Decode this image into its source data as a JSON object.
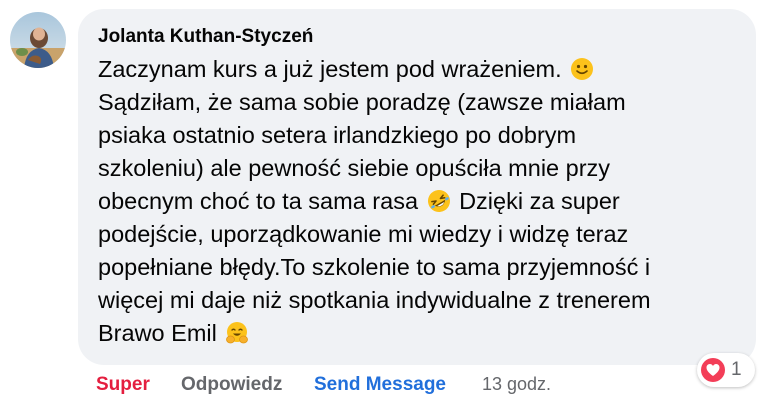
{
  "comment": {
    "author": "Jolanta Kuthan-Styczeń",
    "lines": [
      {
        "text": "Zaczynam kurs a już jestem pod wrażeniem.",
        "emoji_after": "slightly-smiling-face-icon"
      },
      {
        "text": "Sądziłam, że sama sobie poradzę (zawsze miałam"
      },
      {
        "text": "psiaka ostatnio setera irlandzkiego po dobrym"
      },
      {
        "text": "szkoleniu) ale pewność siebie opuściła mnie przy"
      },
      {
        "text": "obecnym choć to ta sama rasa",
        "emoji_after": "rolling-on-floor-laughing-icon",
        "text_after": "Dzięki za super"
      },
      {
        "text": "podejście, uporządkowanie mi wiedzy i widzę teraz"
      },
      {
        "text": "popełniane błędy.To szkolenie to sama przyjemność i"
      },
      {
        "text": "więcej mi daje niż spotkania indywidualne z trenerem"
      },
      {
        "text": "Brawo Emil",
        "emoji_after": "smiling-face-open-hands-icon"
      }
    ]
  },
  "reactions": {
    "icon": "heart-icon",
    "count": "1",
    "color": "#f33e58"
  },
  "actions": {
    "like_label": "Super",
    "like_color": "#e41e3f",
    "reply_label": "Odpowiedz",
    "send_label": "Send Message",
    "send_color": "#216fdb",
    "timestamp": "13 godz."
  }
}
